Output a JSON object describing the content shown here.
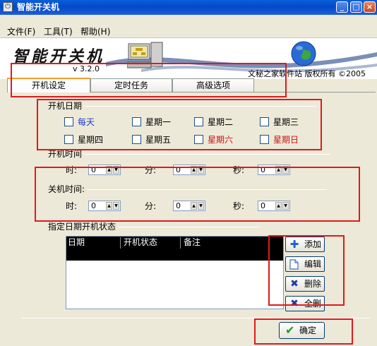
{
  "window": {
    "title": "智能开关机",
    "icon": "power-icon"
  },
  "menu": [
    "文件(F)",
    "工具(T)",
    "帮助(H)"
  ],
  "banner": {
    "logo": "智能开关机",
    "version": "v 3.2.0",
    "company": "文秘之家软件站  版权所有  ©2005"
  },
  "tabs": [
    "开机设定",
    "定时任务",
    "高级选项"
  ],
  "boot_date": {
    "label": "开机日期",
    "days": [
      {
        "label": "每天",
        "color": "#1e3cc8"
      },
      {
        "label": "星期一"
      },
      {
        "label": "星期二"
      },
      {
        "label": "星期三"
      },
      {
        "label": "星期四"
      },
      {
        "label": "星期五"
      },
      {
        "label": "星期六",
        "color": "#d01010"
      },
      {
        "label": "星期日",
        "color": "#d01010"
      }
    ]
  },
  "boot_time": {
    "label": "开机时间",
    "hour_label": "时:",
    "minute_label": "分:",
    "second_label": "秒:",
    "hour": "0",
    "minute": "0",
    "second": "0"
  },
  "shutdown_time": {
    "label": "关机时间:",
    "hour_label": "时:",
    "minute_label": "分:",
    "second_label": "秒:",
    "hour": "0",
    "minute": "0",
    "second": "0"
  },
  "status_section": {
    "label": "指定日期开机状态",
    "columns": [
      "日期",
      "开机状态",
      "备注"
    ]
  },
  "actions": [
    {
      "label": "添加",
      "icon": "plus-icon"
    },
    {
      "label": "编辑",
      "icon": "document-icon"
    },
    {
      "label": "删除",
      "icon": "x-icon"
    },
    {
      "label": "全删",
      "icon": "x-icon"
    }
  ],
  "ok_button": {
    "label": "确定",
    "icon": "checkmark-icon"
  },
  "colors": {
    "titlebar": "#0348c8",
    "highlight": "#e0191b",
    "accent_blue": "#1e3cc8",
    "accent_red": "#d01010"
  }
}
